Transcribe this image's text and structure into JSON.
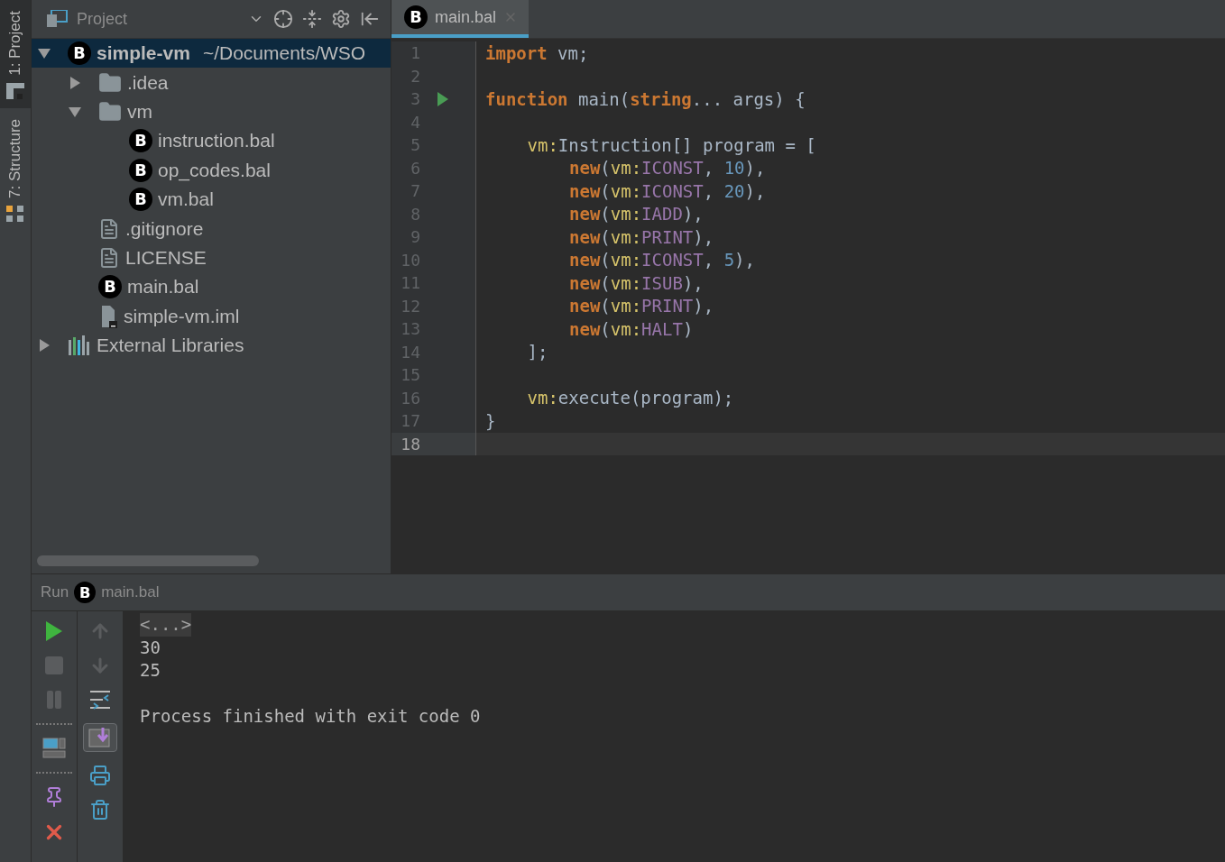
{
  "tool_strip": [
    {
      "label": "1: Project",
      "selected": true,
      "kind": "project"
    },
    {
      "label": "7: Structure",
      "selected": false,
      "kind": "structure"
    }
  ],
  "project": {
    "title": "Project",
    "tree": [
      {
        "label": "simple-vm",
        "path": "~/Documents/WSO",
        "kind": "bal",
        "badge": "B",
        "selected": true,
        "expanded": true,
        "children": [
          {
            "label": ".idea",
            "kind": "folder",
            "selected": false,
            "expanded": false
          },
          {
            "label": "vm",
            "kind": "folder",
            "selected": false,
            "expanded": true,
            "children": [
              {
                "label": "instruction.bal",
                "kind": "bal",
                "badge": "B",
                "selected": false
              },
              {
                "label": "op_codes.bal",
                "kind": "bal",
                "badge": "B",
                "selected": false
              },
              {
                "label": "vm.bal",
                "kind": "bal",
                "badge": "B",
                "selected": false
              }
            ]
          },
          {
            "label": ".gitignore",
            "kind": "text",
            "selected": false
          },
          {
            "label": "LICENSE",
            "kind": "text",
            "selected": false
          },
          {
            "label": "main.bal",
            "kind": "bal",
            "badge": "B",
            "selected": false
          },
          {
            "label": "simple-vm.iml",
            "kind": "module",
            "selected": false
          }
        ]
      },
      {
        "label": "External Libraries",
        "kind": "libraries",
        "selected": false,
        "expanded": false
      }
    ]
  },
  "editor": {
    "tabs": [
      {
        "label": "main.bal",
        "badge": "B",
        "selected": true
      }
    ],
    "lines": [
      {
        "number": "1",
        "run": false,
        "current": false,
        "kind": "top",
        "tokens": [
          {
            "kind": "keyword",
            "text": "import"
          },
          {
            "kind": "plain",
            "text": " vm;"
          }
        ]
      },
      {
        "number": "2",
        "run": false,
        "current": false
      },
      {
        "number": "3",
        "run": true,
        "current": false,
        "kind": "top",
        "tokens": [
          {
            "kind": "keyword",
            "text": "function"
          },
          {
            "kind": "plain",
            "text": " main("
          },
          {
            "kind": "keyword",
            "text": "string"
          },
          {
            "kind": "plain",
            "text": "... args) {"
          }
        ]
      },
      {
        "number": "4",
        "run": false,
        "current": false
      },
      {
        "number": "5",
        "run": false,
        "current": false,
        "kind": "block",
        "tokens": [
          {
            "kind": "ns",
            "text": "vm:"
          },
          {
            "kind": "plain",
            "text": "Instruction[] program = ["
          }
        ]
      },
      {
        "number": "6",
        "run": false,
        "current": false,
        "kind": "nested",
        "tokens": [
          {
            "kind": "keyword",
            "text": "new"
          },
          {
            "kind": "plain",
            "text": "("
          },
          {
            "kind": "ns",
            "text": "vm:"
          },
          {
            "kind": "const",
            "text": "ICONST"
          },
          {
            "kind": "plain",
            "text": ", "
          },
          {
            "kind": "number",
            "text": "10"
          },
          {
            "kind": "plain",
            "text": "),"
          }
        ]
      },
      {
        "number": "7",
        "run": false,
        "current": false,
        "kind": "nested",
        "tokens": [
          {
            "kind": "keyword",
            "text": "new"
          },
          {
            "kind": "plain",
            "text": "("
          },
          {
            "kind": "ns",
            "text": "vm:"
          },
          {
            "kind": "const",
            "text": "ICONST"
          },
          {
            "kind": "plain",
            "text": ", "
          },
          {
            "kind": "number",
            "text": "20"
          },
          {
            "kind": "plain",
            "text": "),"
          }
        ]
      },
      {
        "number": "8",
        "run": false,
        "current": false,
        "kind": "nested",
        "tokens": [
          {
            "kind": "keyword",
            "text": "new"
          },
          {
            "kind": "plain",
            "text": "("
          },
          {
            "kind": "ns",
            "text": "vm:"
          },
          {
            "kind": "const",
            "text": "IADD"
          },
          {
            "kind": "plain",
            "text": "),"
          }
        ]
      },
      {
        "number": "9",
        "run": false,
        "current": false,
        "kind": "nested",
        "tokens": [
          {
            "kind": "keyword",
            "text": "new"
          },
          {
            "kind": "plain",
            "text": "("
          },
          {
            "kind": "ns",
            "text": "vm:"
          },
          {
            "kind": "const",
            "text": "PRINT"
          },
          {
            "kind": "plain",
            "text": "),"
          }
        ]
      },
      {
        "number": "10",
        "run": false,
        "current": false,
        "kind": "nested",
        "tokens": [
          {
            "kind": "keyword",
            "text": "new"
          },
          {
            "kind": "plain",
            "text": "("
          },
          {
            "kind": "ns",
            "text": "vm:"
          },
          {
            "kind": "const",
            "text": "ICONST"
          },
          {
            "kind": "plain",
            "text": ", "
          },
          {
            "kind": "number",
            "text": "5"
          },
          {
            "kind": "plain",
            "text": "),"
          }
        ]
      },
      {
        "number": "11",
        "run": false,
        "current": false,
        "kind": "nested",
        "tokens": [
          {
            "kind": "keyword",
            "text": "new"
          },
          {
            "kind": "plain",
            "text": "("
          },
          {
            "kind": "ns",
            "text": "vm:"
          },
          {
            "kind": "const",
            "text": "ISUB"
          },
          {
            "kind": "plain",
            "text": "),"
          }
        ]
      },
      {
        "number": "12",
        "run": false,
        "current": false,
        "kind": "nested",
        "tokens": [
          {
            "kind": "keyword",
            "text": "new"
          },
          {
            "kind": "plain",
            "text": "("
          },
          {
            "kind": "ns",
            "text": "vm:"
          },
          {
            "kind": "const",
            "text": "PRINT"
          },
          {
            "kind": "plain",
            "text": "),"
          }
        ]
      },
      {
        "number": "13",
        "run": false,
        "current": false,
        "kind": "nested",
        "tokens": [
          {
            "kind": "keyword",
            "text": "new"
          },
          {
            "kind": "plain",
            "text": "("
          },
          {
            "kind": "ns",
            "text": "vm:"
          },
          {
            "kind": "const",
            "text": "HALT"
          },
          {
            "kind": "plain",
            "text": ")"
          }
        ]
      },
      {
        "number": "14",
        "run": false,
        "current": false,
        "kind": "block",
        "tokens": [
          {
            "kind": "plain",
            "text": "];"
          }
        ]
      },
      {
        "number": "15",
        "run": false,
        "current": false
      },
      {
        "number": "16",
        "run": false,
        "current": false,
        "kind": "block",
        "tokens": [
          {
            "kind": "ns",
            "text": "vm:"
          },
          {
            "kind": "plain",
            "text": "execute(program);"
          }
        ]
      },
      {
        "number": "17",
        "run": false,
        "current": false,
        "kind": "top",
        "tokens": [
          {
            "kind": "plain",
            "text": "}"
          }
        ]
      },
      {
        "number": "18",
        "run": false,
        "current": true
      }
    ]
  },
  "run": {
    "title": "Run",
    "tab": {
      "label": "main.bal",
      "badge": "B"
    },
    "autoscroll": true,
    "console": [
      {
        "kind": "folded",
        "text": "<...>"
      },
      {
        "kind": "output",
        "text": "30"
      },
      {
        "kind": "output",
        "text": "25"
      },
      {
        "kind": "status",
        "text": "Process finished with exit code 0"
      }
    ]
  }
}
